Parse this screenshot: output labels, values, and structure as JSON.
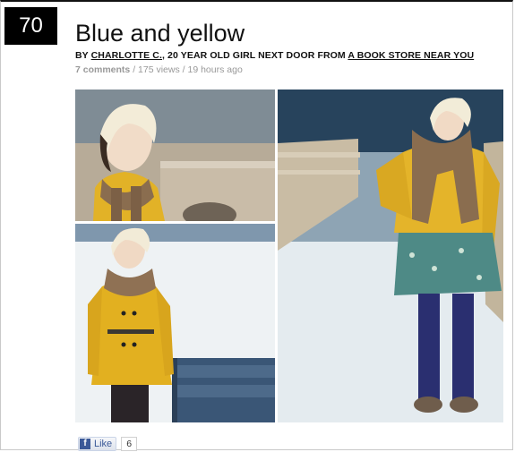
{
  "post": {
    "rank": "70",
    "title": "Blue and yellow",
    "byline_prefix": "BY ",
    "author": "CHARLOTTE C.",
    "byline_middle": ", 20 YEAR OLD GIRL NEXT DOOR FROM ",
    "location": "A BOOK STORE NEAR YOU",
    "comments": "7 comments",
    "views": "/ 175 views / 19 hours ago"
  },
  "like": {
    "label": "Like",
    "count": "6",
    "icon": "facebook-icon"
  },
  "colors": {
    "accent_black": "#000000",
    "facebook_blue": "#3b5998"
  }
}
